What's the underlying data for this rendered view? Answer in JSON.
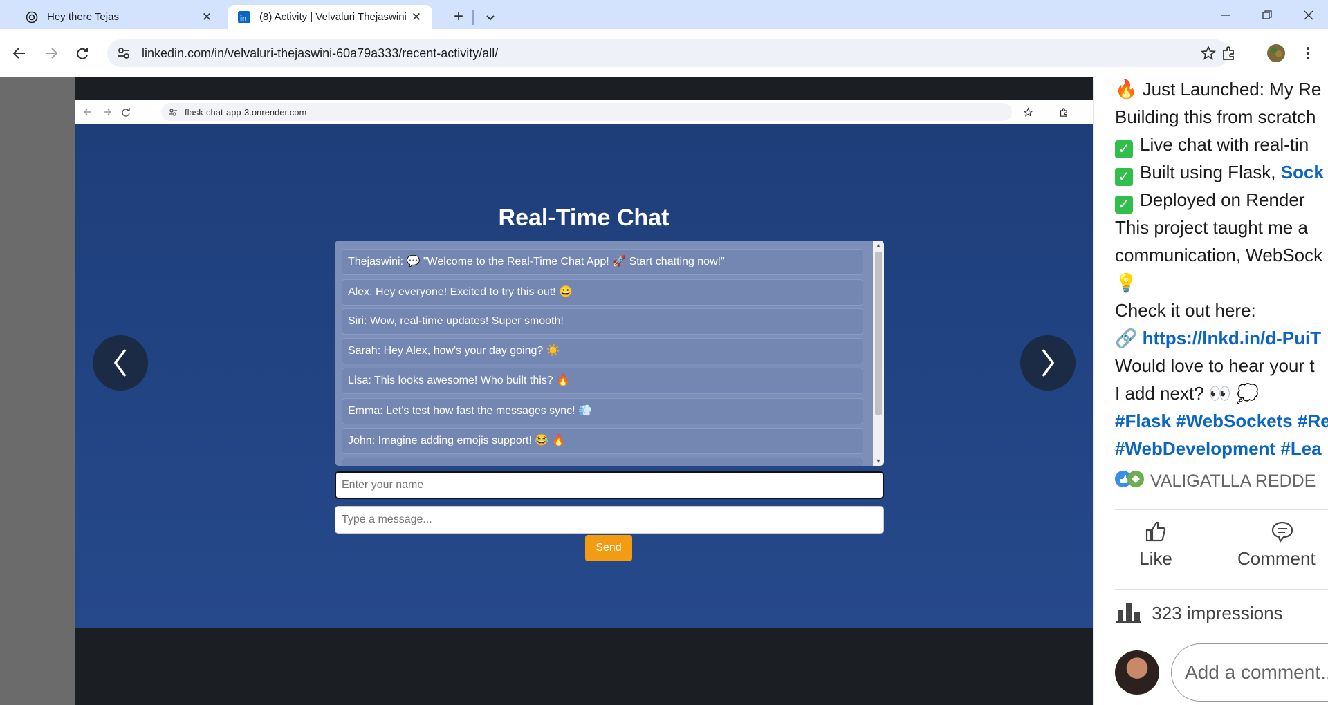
{
  "browser": {
    "tabs": [
      {
        "title": "Hey there Tejas",
        "icon": "openai-icon",
        "active": false
      },
      {
        "title": "(8) Activity | Velvaluri Thejaswini",
        "icon": "linkedin-icon",
        "active": true
      }
    ],
    "url": "linkedin.com/in/velvaluri-thejaswini-60a79a333/recent-activity/all/"
  },
  "screenshot": {
    "url": "flask-chat-app-3.onrender.com",
    "chat": {
      "title": "Real-Time Chat",
      "messages": [
        "Thejaswini: 💬 \"Welcome to the Real-Time Chat App! 🚀 Start chatting now!\"",
        "Alex: Hey everyone! Excited to try this out! 😀",
        "Siri: Wow, real-time updates! Super smooth!",
        "Sarah: Hey Alex, how's your day going? ☀️",
        "Lisa: This looks awesome! Who built this? 🔥",
        "Emma: Let's test how fast the messages sync! 💨",
        "John: Imagine adding emojis support! 😂 🔥"
      ],
      "name_placeholder": "Enter your name",
      "message_placeholder": "Type a message...",
      "send_label": "Send"
    }
  },
  "post": {
    "line1": "Just Launched: My Re",
    "line2": "Building this from scratch",
    "check1": "Live chat with real-tin",
    "check2_text": "Built using Flask, ",
    "check2_link": "Sock",
    "check3": "Deployed on Render",
    "line6": "This project taught me a",
    "line7": "communication, WebSock",
    "line9": "Check it out here:",
    "link": "https://lnkd.in/d-PuiT",
    "line11": "Would love to hear your t",
    "line12": "I add next? 👀 💭",
    "hashtags1": "#Flask #WebSockets #Re",
    "hashtags2": "#WebDevelopment #Lea",
    "reactor": "VALIGATLLA REDDE",
    "like_label": "Like",
    "comment_label": "Comment",
    "impressions": "323 impressions",
    "comment_placeholder": "Add a comment..."
  },
  "colors": {
    "accent_orange": "#f39c12",
    "chat_bg": "#26498b",
    "linkedin_blue": "#0a66c2",
    "check_green": "#2fbf4a"
  }
}
